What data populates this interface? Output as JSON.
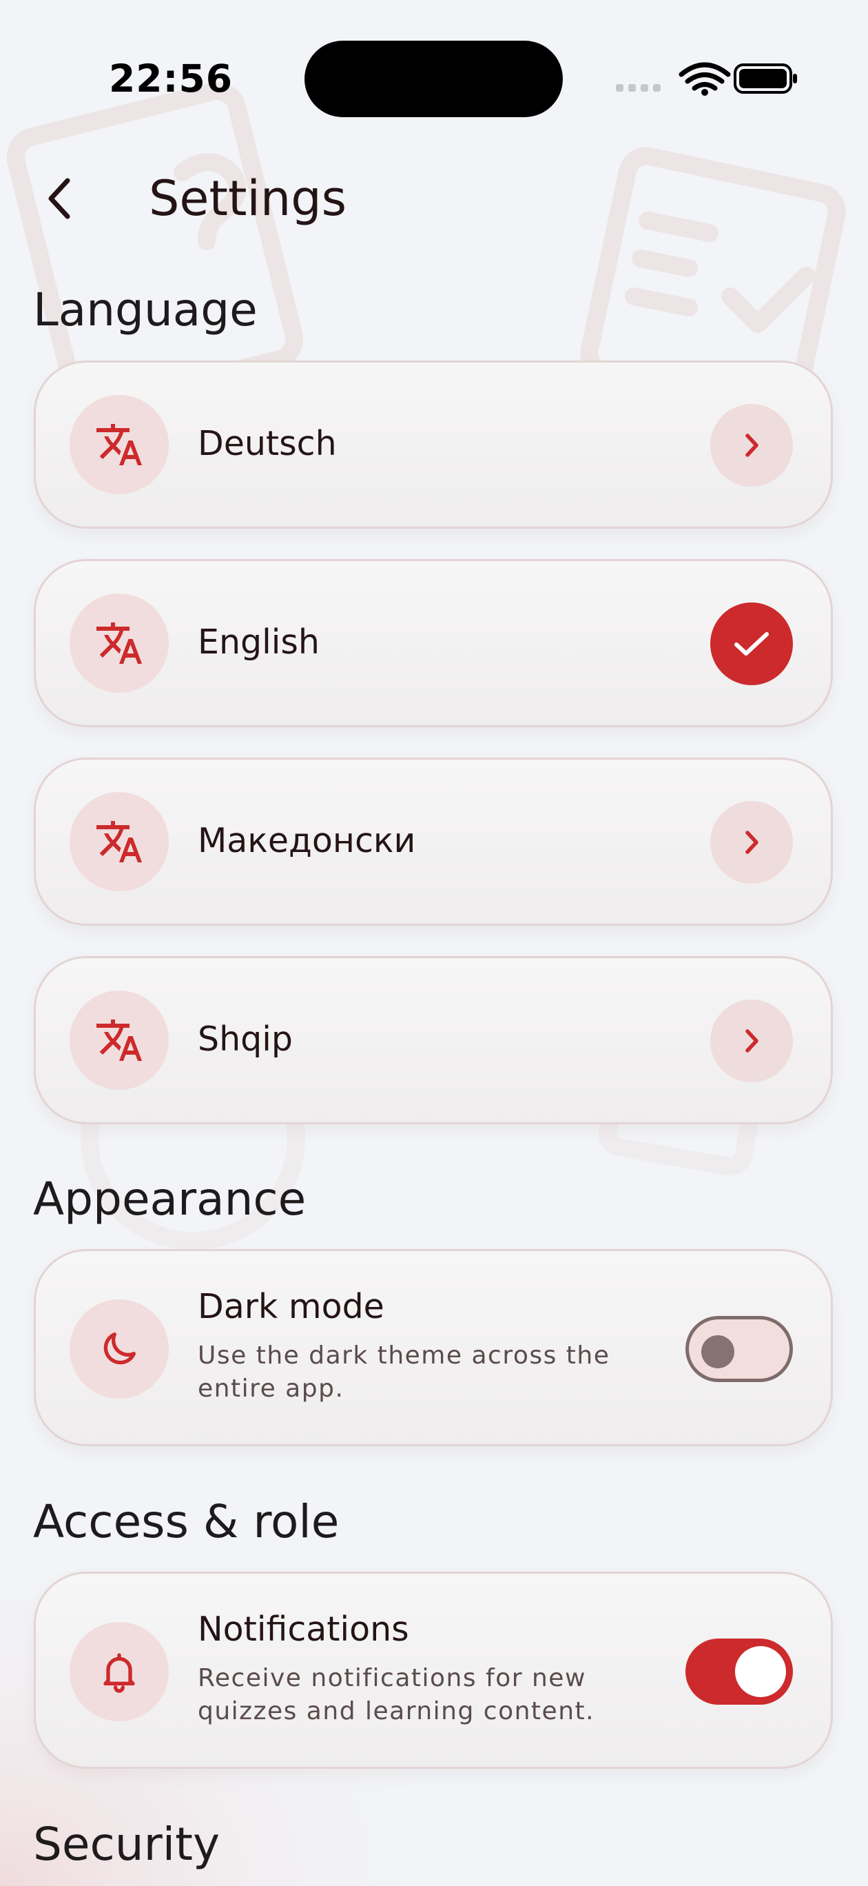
{
  "status_bar": {
    "time": "22:56"
  },
  "header": {
    "title": "Settings",
    "back_icon": "chevron-left-icon"
  },
  "colors": {
    "accent": "#cc2a2c",
    "icon_bg": "#f1dddd",
    "background": "#f2f4f7"
  },
  "sections": {
    "language": {
      "title": "Language",
      "items": [
        {
          "label": "Deutsch",
          "icon": "translate-icon",
          "state": "chevron"
        },
        {
          "label": "English",
          "icon": "translate-icon",
          "state": "selected"
        },
        {
          "label": "Македонски",
          "icon": "translate-icon",
          "state": "chevron"
        },
        {
          "label": "Shqip",
          "icon": "translate-icon",
          "state": "chevron"
        }
      ]
    },
    "appearance": {
      "title": "Appearance",
      "dark_mode": {
        "title": "Dark mode",
        "description": "Use the dark theme across the entire app.",
        "icon": "moon-icon",
        "enabled": false
      }
    },
    "access": {
      "title": "Access & role",
      "notifications": {
        "title": "Notifications",
        "description": "Receive notifications for new quizzes and learning content.",
        "icon": "bell-icon",
        "enabled": true
      }
    },
    "security": {
      "title": "Security"
    }
  }
}
